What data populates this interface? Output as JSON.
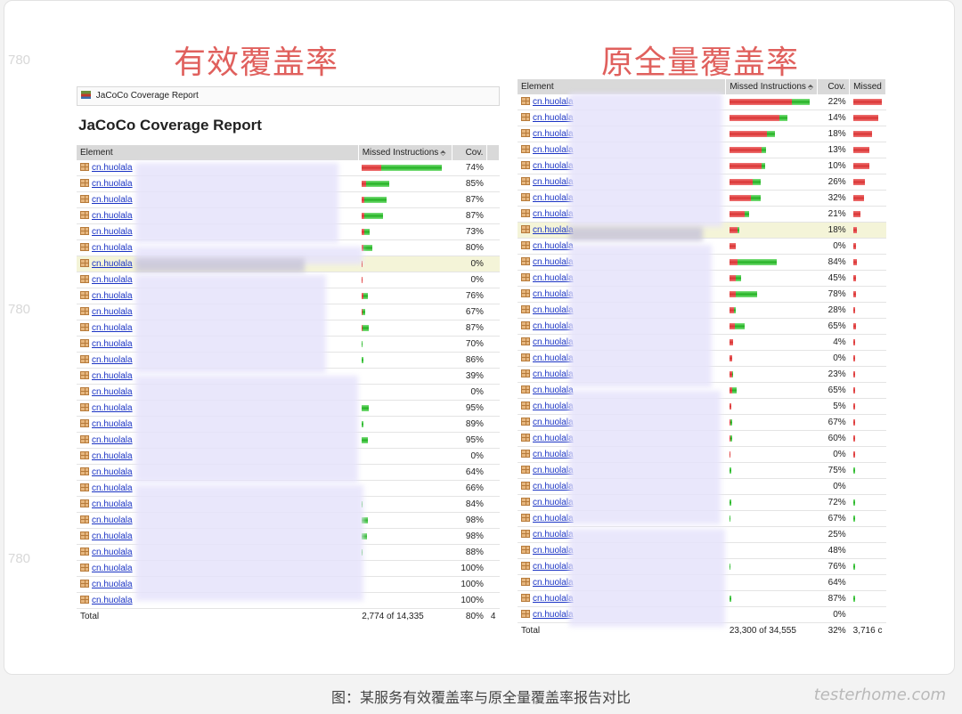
{
  "left_heading": "有效覆盖率",
  "right_heading": "原全量覆盖率",
  "breadcrumb": "JaCoCo Coverage Report",
  "report_title": "JaCoCo Coverage Report",
  "columns": {
    "element": "Element",
    "missed": "Missed Instructions",
    "cov": "Cov.",
    "missed_short": "Missed",
    "sort_glyph": "⬘"
  },
  "package_name": "cn.huolala",
  "left": {
    "rows": [
      {
        "cov": "74%",
        "red": 22,
        "green": 68
      },
      {
        "cov": "85%",
        "red": 5,
        "green": 26
      },
      {
        "cov": "87%",
        "red": 3,
        "green": 25
      },
      {
        "cov": "87%",
        "red": 3,
        "green": 21
      },
      {
        "cov": "73%",
        "red": 3,
        "green": 6
      },
      {
        "cov": "80%",
        "red": 2,
        "green": 10
      },
      {
        "cov": "0%",
        "red": 1,
        "green": 0
      },
      {
        "cov": "0%",
        "red": 1,
        "green": 0
      },
      {
        "cov": "76%",
        "red": 2,
        "green": 5
      },
      {
        "cov": "67%",
        "red": 1,
        "green": 3
      },
      {
        "cov": "87%",
        "red": 1,
        "green": 7
      },
      {
        "cov": "70%",
        "red": 0,
        "green": 1
      },
      {
        "cov": "86%",
        "red": 0,
        "green": 2
      },
      {
        "cov": "39%",
        "red": 0,
        "green": 0
      },
      {
        "cov": "0%",
        "red": 0,
        "green": 0
      },
      {
        "cov": "95%",
        "red": 0,
        "green": 8
      },
      {
        "cov": "89%",
        "red": 0,
        "green": 2
      },
      {
        "cov": "95%",
        "red": 0,
        "green": 7
      },
      {
        "cov": "0%",
        "red": 0,
        "green": 0
      },
      {
        "cov": "64%",
        "red": 0,
        "green": 0
      },
      {
        "cov": "66%",
        "red": 0,
        "green": 0
      },
      {
        "cov": "84%",
        "red": 0,
        "green": 1
      },
      {
        "cov": "98%",
        "red": 0,
        "green": 7
      },
      {
        "cov": "98%",
        "red": 0,
        "green": 6
      },
      {
        "cov": "88%",
        "red": 0,
        "green": 1
      },
      {
        "cov": "100%",
        "red": 0,
        "green": 0
      },
      {
        "cov": "100%",
        "red": 0,
        "green": 0
      },
      {
        "cov": "100%",
        "red": 0,
        "green": 0
      }
    ],
    "total_label": "Total",
    "total_missed": "2,774 of 14,335",
    "total_cov": "80%",
    "total_extra": "4"
  },
  "right": {
    "rows": [
      {
        "cov": "22%",
        "red": 70,
        "green": 20
      },
      {
        "cov": "14%",
        "red": 56,
        "green": 9
      },
      {
        "cov": "18%",
        "red": 42,
        "green": 9
      },
      {
        "cov": "13%",
        "red": 36,
        "green": 5
      },
      {
        "cov": "10%",
        "red": 36,
        "green": 4
      },
      {
        "cov": "26%",
        "red": 26,
        "green": 9
      },
      {
        "cov": "32%",
        "red": 24,
        "green": 11
      },
      {
        "cov": "21%",
        "red": 17,
        "green": 5
      },
      {
        "cov": "18%",
        "red": 9,
        "green": 2
      },
      {
        "cov": "0%",
        "red": 7,
        "green": 0
      },
      {
        "cov": "84%",
        "red": 9,
        "green": 44
      },
      {
        "cov": "45%",
        "red": 7,
        "green": 6
      },
      {
        "cov": "78%",
        "red": 7,
        "green": 24
      },
      {
        "cov": "28%",
        "red": 5,
        "green": 2
      },
      {
        "cov": "65%",
        "red": 6,
        "green": 11
      },
      {
        "cov": "4%",
        "red": 4,
        "green": 0
      },
      {
        "cov": "0%",
        "red": 3,
        "green": 0
      },
      {
        "cov": "23%",
        "red": 3,
        "green": 1
      },
      {
        "cov": "65%",
        "red": 3,
        "green": 5
      },
      {
        "cov": "5%",
        "red": 2,
        "green": 0
      },
      {
        "cov": "67%",
        "red": 1,
        "green": 2
      },
      {
        "cov": "60%",
        "red": 1,
        "green": 2
      },
      {
        "cov": "0%",
        "red": 1,
        "green": 0
      },
      {
        "cov": "75%",
        "red": 0,
        "green": 2
      },
      {
        "cov": "0%",
        "red": 0,
        "green": 0
      },
      {
        "cov": "72%",
        "red": 0,
        "green": 2
      },
      {
        "cov": "67%",
        "red": 0,
        "green": 1
      },
      {
        "cov": "25%",
        "red": 0,
        "green": 0
      },
      {
        "cov": "48%",
        "red": 0,
        "green": 0
      },
      {
        "cov": "76%",
        "red": 0,
        "green": 1
      },
      {
        "cov": "64%",
        "red": 0,
        "green": 0
      },
      {
        "cov": "87%",
        "red": 0,
        "green": 2
      },
      {
        "cov": "0%",
        "red": 0,
        "green": 0
      }
    ],
    "total_label": "Total",
    "total_missed": "23,300 of 34,555",
    "total_cov": "32%",
    "total_extra": "3,716 c"
  },
  "caption": "图：某服务有效覆盖率与原全量覆盖率报告对比",
  "watermark_brand": "testerhome.com",
  "edge_marks": [
    "780",
    "780",
    "780"
  ],
  "colors": {
    "heading": "#e0605d",
    "link": "#1a33c4",
    "bar_red": "#d93434",
    "bar_green": "#22b122",
    "highlight_row": "#f4f4d8"
  }
}
